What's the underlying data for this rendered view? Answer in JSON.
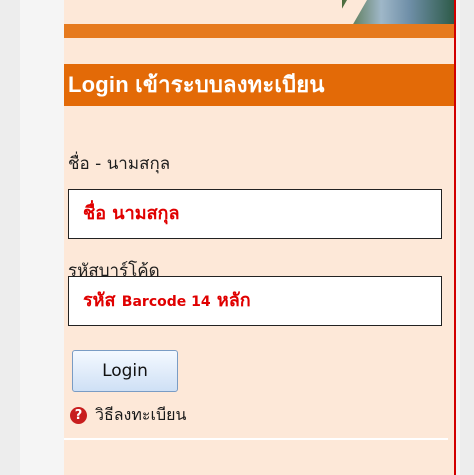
{
  "login": {
    "header": "Login เข้าระบบลงทะเบียน",
    "name_label": "ชื่อ - นามสกุล",
    "name_placeholder": "ชื่อ นามสกุล",
    "barcode_label": "รหัสบาร์โค้ด",
    "barcode_placeholder_prefix": "รหัส ",
    "barcode_placeholder_mid": "Barcode 14",
    "barcode_placeholder_suffix": " หลัก",
    "button": "Login",
    "help_link": "วิธีลงทะเบียน",
    "help_icon": "question-icon"
  },
  "colors": {
    "header_bg": "#e36a07",
    "panel_bg": "#fde8d8",
    "placeholder_text": "#e00000",
    "border_accent": "#d20000"
  }
}
